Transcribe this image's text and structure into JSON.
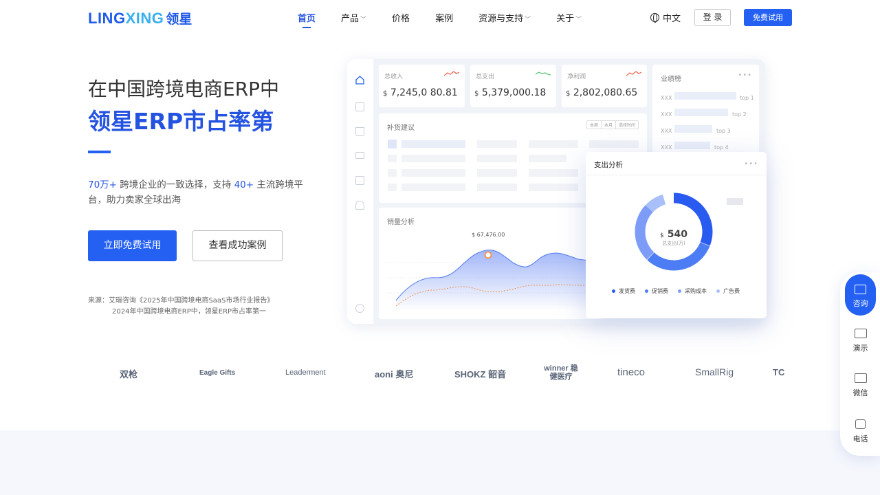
{
  "nav": {
    "logo_en_a": "LING",
    "logo_en_b": "XING",
    "logo_zh": "领星",
    "menu": [
      "首页",
      "产品",
      "价格",
      "案例",
      "资源与支持",
      "关于"
    ],
    "lang": "中文",
    "login": "登 录",
    "trial": "免费试用"
  },
  "hero": {
    "line1": "在中国跨境电商ERP中",
    "line2": "领星ERP市占率第",
    "desc_hl1": "70万+",
    "desc_t1": " 跨境企业的一致选择，支持 ",
    "desc_hl2": "40+",
    "desc_t2": " 主流跨境平台，助力卖家全球出海",
    "btn_free": "立即免费试用",
    "btn_case": "查看成功案例",
    "source1": "来源：艾瑞咨询《2025年中国跨境电商SaaS市场行业报告》",
    "source2": "2024年中国跨境电商ERP中，领星ERP市占率第一"
  },
  "dashboard": {
    "kpis": [
      {
        "label": "总收入",
        "currency": "$",
        "value": "7,245,0 80.81"
      },
      {
        "label": "总支出",
        "currency": "$",
        "value": "5,379,000.18"
      },
      {
        "label": "净利润",
        "currency": "$",
        "value": "2,802,080.65"
      }
    ],
    "ranking_title": "业绩榜",
    "ranking_items": [
      {
        "name": "XXX",
        "tag": "top 1"
      },
      {
        "name": "XXX",
        "tag": "top 2"
      },
      {
        "name": "XXX",
        "tag": "top 3"
      },
      {
        "name": "XXX",
        "tag": "top 4"
      }
    ],
    "restock_title": "补货建议",
    "restock_tabs": [
      "本周",
      "本月",
      "选择时间"
    ],
    "sales_title": "销量分析",
    "sales_peak": "$ 67,476.00",
    "expense": {
      "title": "支出分析",
      "center_value": "540",
      "center_currency": "$",
      "center_label": "总支出(万)",
      "legend": [
        "发货费",
        "促销费",
        "采购成本",
        "广告费"
      ],
      "colors": [
        "#2a5bf0",
        "#4d7df5",
        "#7c9cf7",
        "#a9bff9"
      ]
    }
  },
  "brands": [
    "双枪",
    "Eagle Gifts",
    "Leaderment",
    "aoni 奥尼",
    "SHOKZ 韶音",
    "winner 稳健医疗",
    "tineco",
    "SmallRig",
    "TC"
  ],
  "float": {
    "consult": "咨询",
    "demo": "演示",
    "wechat": "微信",
    "phone": "电话"
  }
}
